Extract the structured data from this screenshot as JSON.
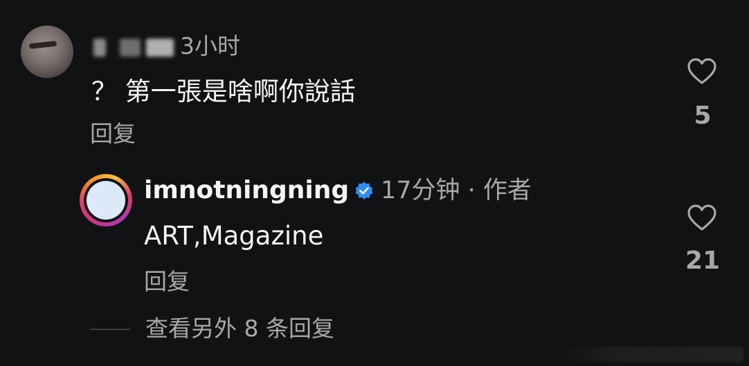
{
  "comments": [
    {
      "time": "3小时",
      "text": "？ 第一張是啥啊你說話",
      "reply_label": "回复",
      "like_icon": "heart-outline-icon",
      "like_count": "5"
    },
    {
      "username": "imnotningning",
      "verified": true,
      "time_role": "17分钟 · 作者",
      "text": "ART,Magazine",
      "reply_label": "回复",
      "like_icon": "heart-outline-icon",
      "like_count": "21"
    }
  ],
  "view_more_replies": "查看另外 8 条回复",
  "colors": {
    "background": "#101214",
    "primary_text": "#f5f5f5",
    "secondary_text": "#a8a8a8",
    "verified_blue": "#2f8cf0"
  }
}
